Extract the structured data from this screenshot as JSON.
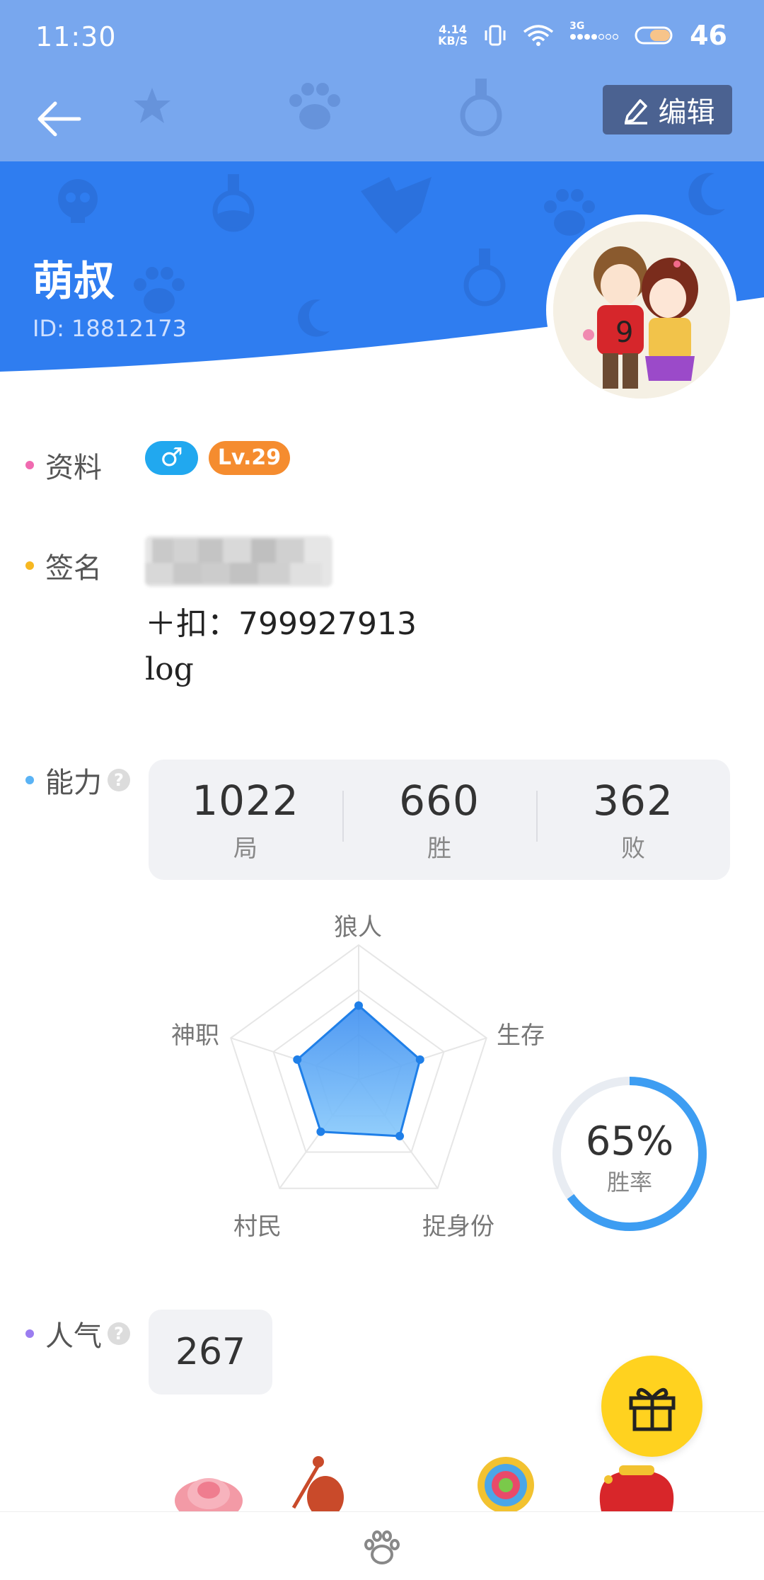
{
  "status_bar": {
    "time": "11:30",
    "net_speed_value": "4.14",
    "net_speed_unit": "KB/S",
    "network_type": "3G",
    "battery": "46"
  },
  "header": {
    "edit_label": "编辑",
    "user_name": "萌叔",
    "user_id": "ID: 18812173"
  },
  "profile": {
    "info_label": "资料",
    "gender_symbol": "♂",
    "level": "Lv.29",
    "signature_label": "签名",
    "signature_lines": [
      "＋扣：799927913",
      "log"
    ]
  },
  "ability": {
    "label": "能力",
    "help": "?",
    "stats": [
      {
        "value": "1022",
        "label": "局"
      },
      {
        "value": "660",
        "label": "胜"
      },
      {
        "value": "362",
        "label": "败"
      }
    ],
    "radar_axes": [
      "狼人",
      "生存",
      "捉身份",
      "村民",
      "神职"
    ],
    "radar_values": [
      0.55,
      0.48,
      0.52,
      0.48,
      0.48
    ],
    "win_rate": 0.65,
    "win_rate_text": "65%",
    "win_rate_label": "胜率"
  },
  "popularity": {
    "label": "人气",
    "help": "?",
    "value": "267"
  },
  "colors": {
    "accent": "#2f7df0",
    "header_light": "#78a7ee",
    "level_badge": "#f58c2f",
    "gender_badge": "#21a8ef",
    "gift_button": "#ffd21f",
    "dot_info": "#f06ab0",
    "dot_signature": "#f7b821",
    "dot_ability": "#5ab3f5",
    "dot_popularity": "#9b7df0"
  },
  "icons": [
    "back-arrow-icon",
    "edit-pencil-icon",
    "help-icon",
    "gift-icon",
    "paw-icon"
  ]
}
